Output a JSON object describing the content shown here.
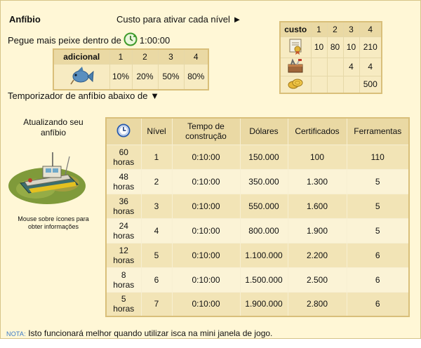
{
  "title": "Anfíbio",
  "cost_hint": "Custo para ativar cada nível ►",
  "catch_more": {
    "label": "Pegue mais peixe dentro de",
    "time": "1:00:00"
  },
  "adicional": {
    "header": "adicional",
    "levels": [
      "1",
      "2",
      "3",
      "4"
    ],
    "values": [
      "10%",
      "20%",
      "50%",
      "80%"
    ]
  },
  "custo": {
    "header": "custo",
    "levels": [
      "1",
      "2",
      "3",
      "4"
    ],
    "rows": [
      {
        "icon": "certificate-icon",
        "values": [
          "10",
          "80",
          "10",
          "210"
        ]
      },
      {
        "icon": "toolbox-icon",
        "values": [
          "",
          "",
          "4",
          "4"
        ]
      },
      {
        "icon": "coins-icon",
        "values": [
          "",
          "",
          "",
          "500"
        ]
      }
    ]
  },
  "timer_below": "Temporizador de anfíbio abaixo de ▼",
  "upgrade": {
    "title": "Atualizando seu anfíbio",
    "hint": "Mouse sobre ícones para obter informações"
  },
  "main": {
    "headers": [
      "Nível",
      "Tempo de construção",
      "Dólares",
      "Certificados",
      "Ferramentas"
    ],
    "rows": [
      {
        "hours": "60",
        "unit": "horas",
        "level": "1",
        "time": "0:10:00",
        "dollars": "150.000",
        "certs": "100",
        "tools": "110"
      },
      {
        "hours": "48",
        "unit": "horas",
        "level": "2",
        "time": "0:10:00",
        "dollars": "350.000",
        "certs": "1.300",
        "tools": "5"
      },
      {
        "hours": "36",
        "unit": "horas",
        "level": "3",
        "time": "0:10:00",
        "dollars": "550.000",
        "certs": "1.600",
        "tools": "5"
      },
      {
        "hours": "24",
        "unit": "horas",
        "level": "4",
        "time": "0:10:00",
        "dollars": "800.000",
        "certs": "1.900",
        "tools": "5"
      },
      {
        "hours": "12",
        "unit": "horas",
        "level": "5",
        "time": "0:10:00",
        "dollars": "1.100.000",
        "certs": "2.200",
        "tools": "6"
      },
      {
        "hours": "8",
        "unit": "horas",
        "level": "6",
        "time": "0:10:00",
        "dollars": "1.500.000",
        "certs": "2.500",
        "tools": "6"
      },
      {
        "hours": "5",
        "unit": "horas",
        "level": "7",
        "time": "0:10:00",
        "dollars": "1.900.000",
        "certs": "2.800",
        "tools": "6"
      }
    ]
  },
  "note": {
    "label": "NOTA:",
    "text": "Isto funcionará melhor quando utilizar isca na mini janela de jogo."
  }
}
